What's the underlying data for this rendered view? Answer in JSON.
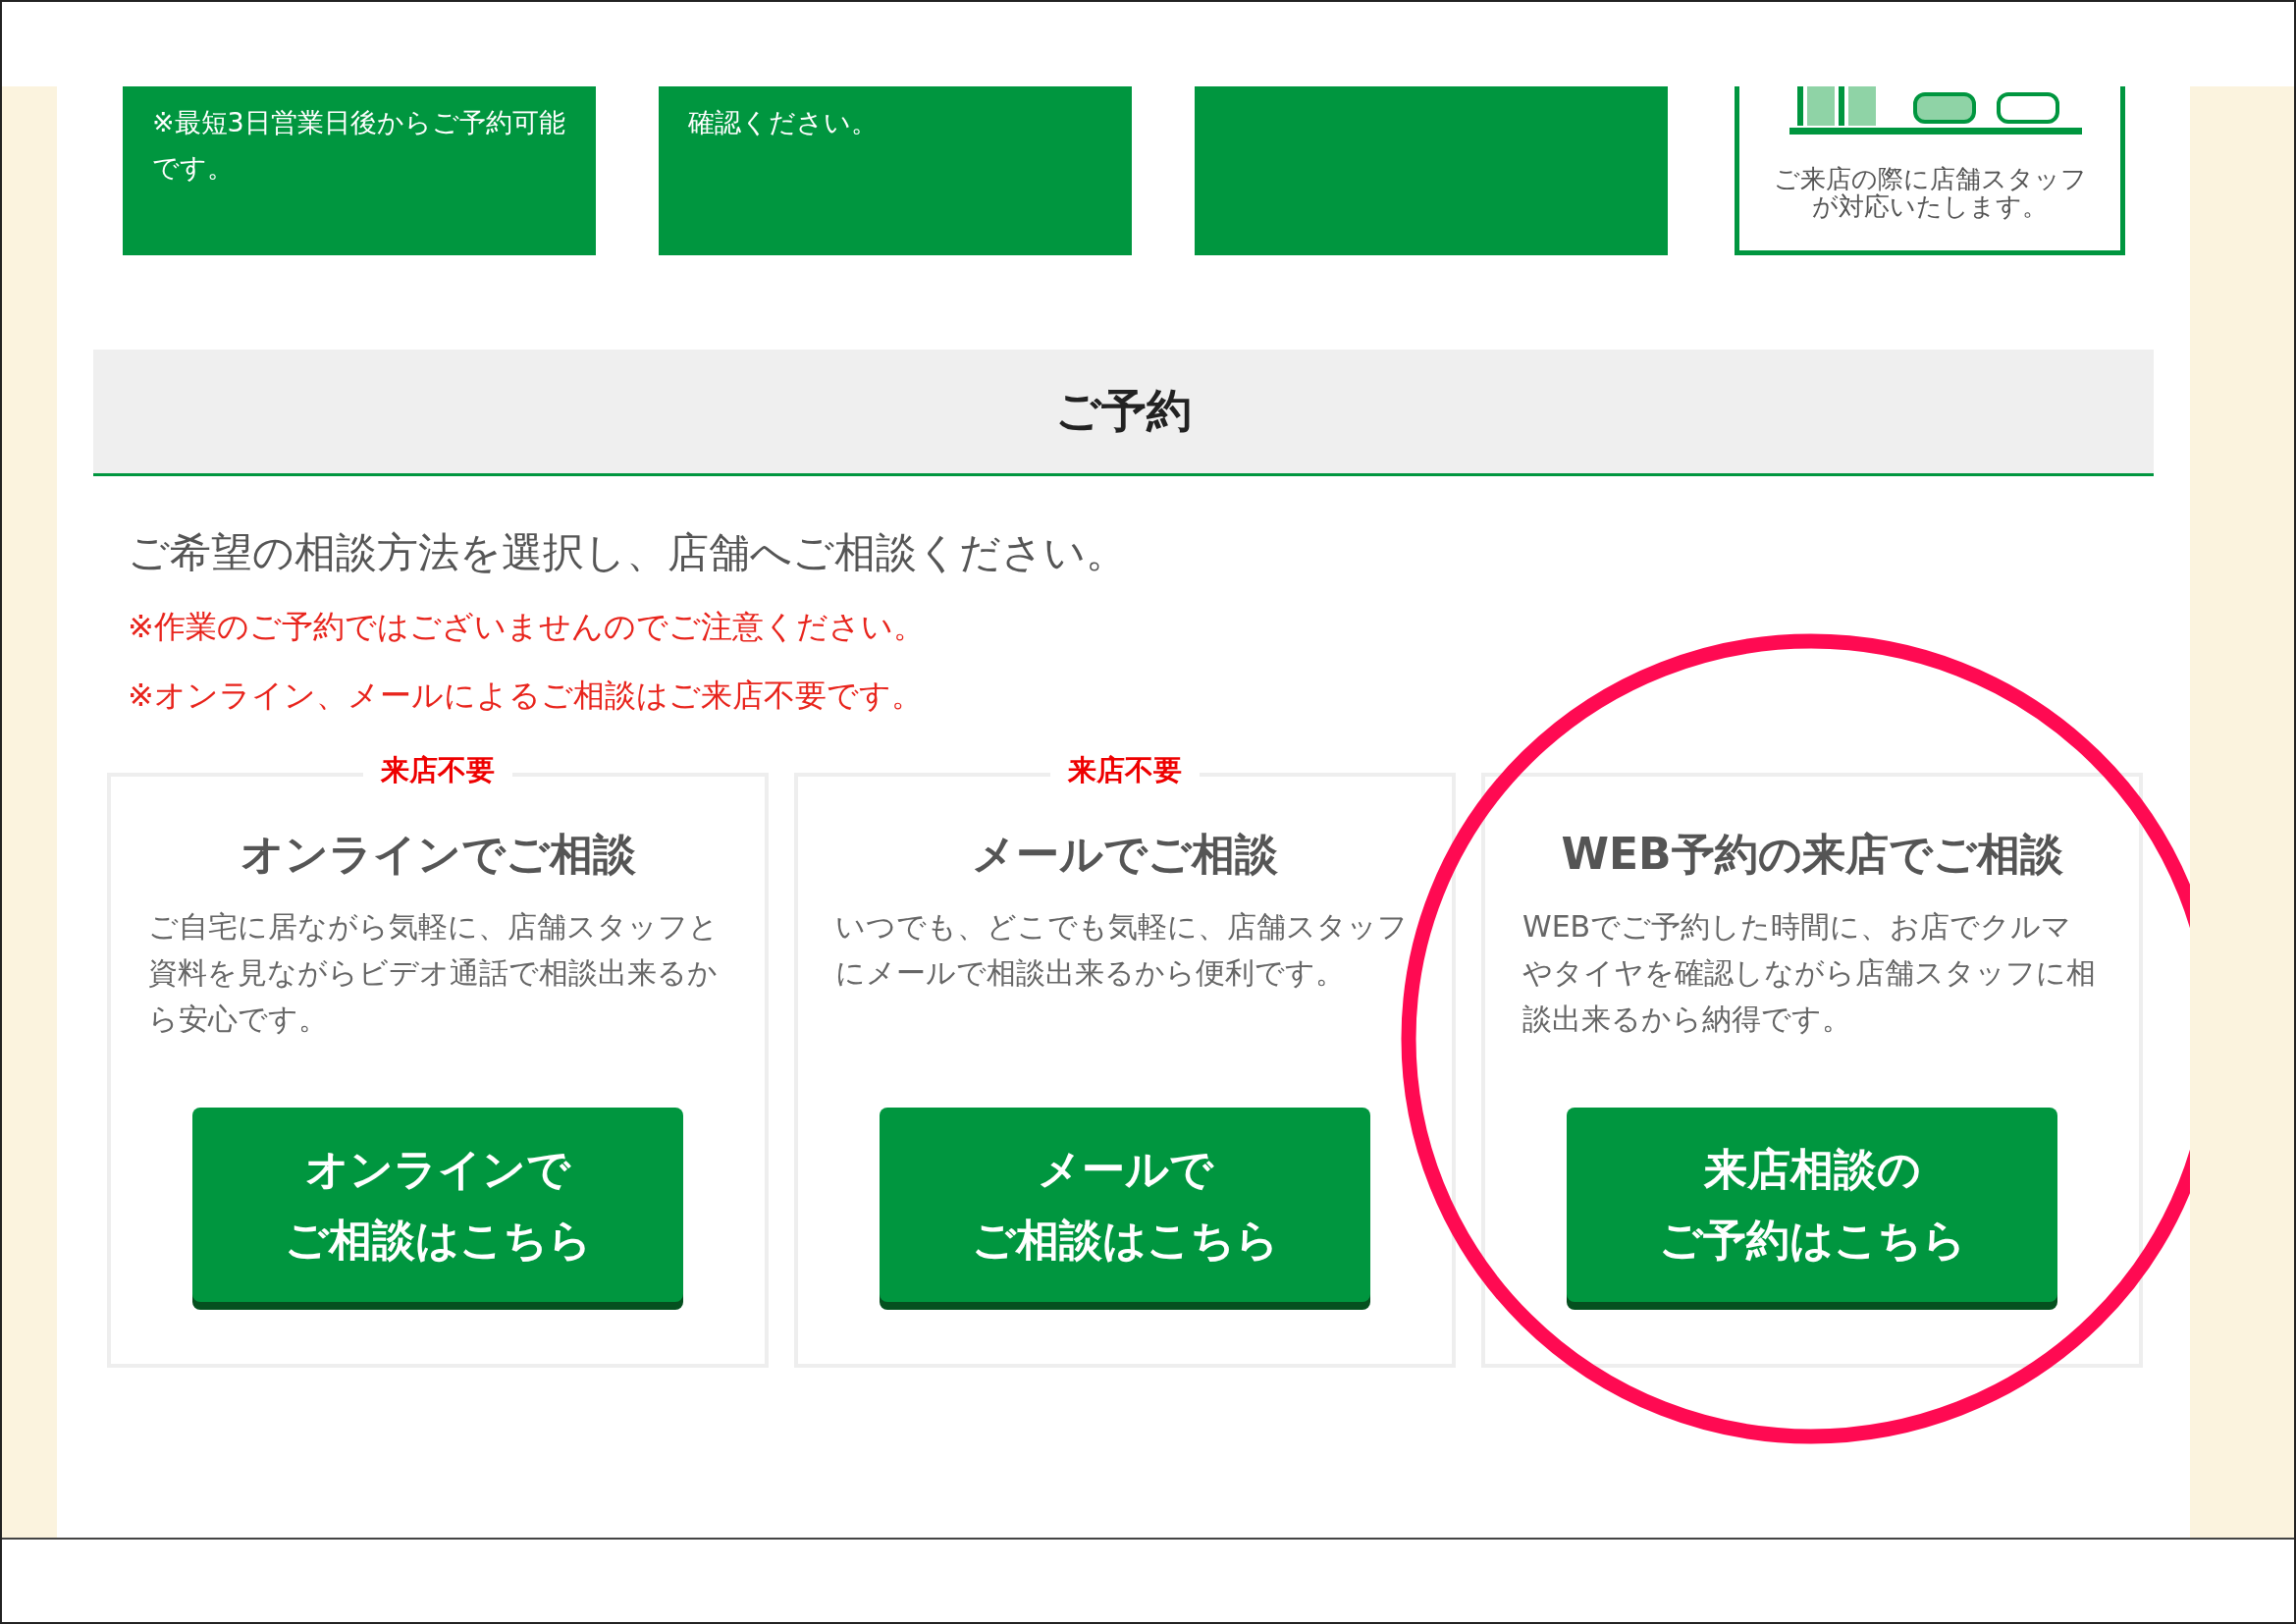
{
  "steps": [
    {
      "kind": "green",
      "text": "※最短3日営業日後からご予約可能です。"
    },
    {
      "kind": "green",
      "text": "確認ください。"
    },
    {
      "kind": "green"
    },
    {
      "kind": "outline",
      "text": "ご来店の際に店舗スタッフが対応いたします。"
    }
  ],
  "section": {
    "title": "ご予約"
  },
  "intro": "ご希望の相談方法を選択し、店舗へご相談ください。",
  "notes": [
    "※作業のご予約ではございませんのでご注意ください。",
    "※オンライン、メールによるご相談はご来店不要です。"
  ],
  "options": [
    {
      "badge": "来店不要",
      "title": "オンラインでご相談",
      "description": "ご自宅に居ながら気軽に、店舗スタッフと資料を見ながらビデオ通話で相談出来るから安心です。",
      "button": [
        "オンラインで",
        "ご相談はこちら"
      ],
      "highlighted": false
    },
    {
      "badge": "来店不要",
      "title": "メールでご相談",
      "description": "いつでも、どこでも気軽に、店舗スタッフにメールで相談出来るから便利です。",
      "button": [
        "メールで",
        "ご相談はこちら"
      ],
      "highlighted": false
    },
    {
      "title": "WEB予約の来店でご相談",
      "description": "WEBでご予約した時間に、お店でクルマやタイヤを確認しながら店舗スタッフに相談出来るから納得です。",
      "button": [
        "来店相談の",
        "ご予約はこちら"
      ],
      "highlighted": true
    }
  ]
}
